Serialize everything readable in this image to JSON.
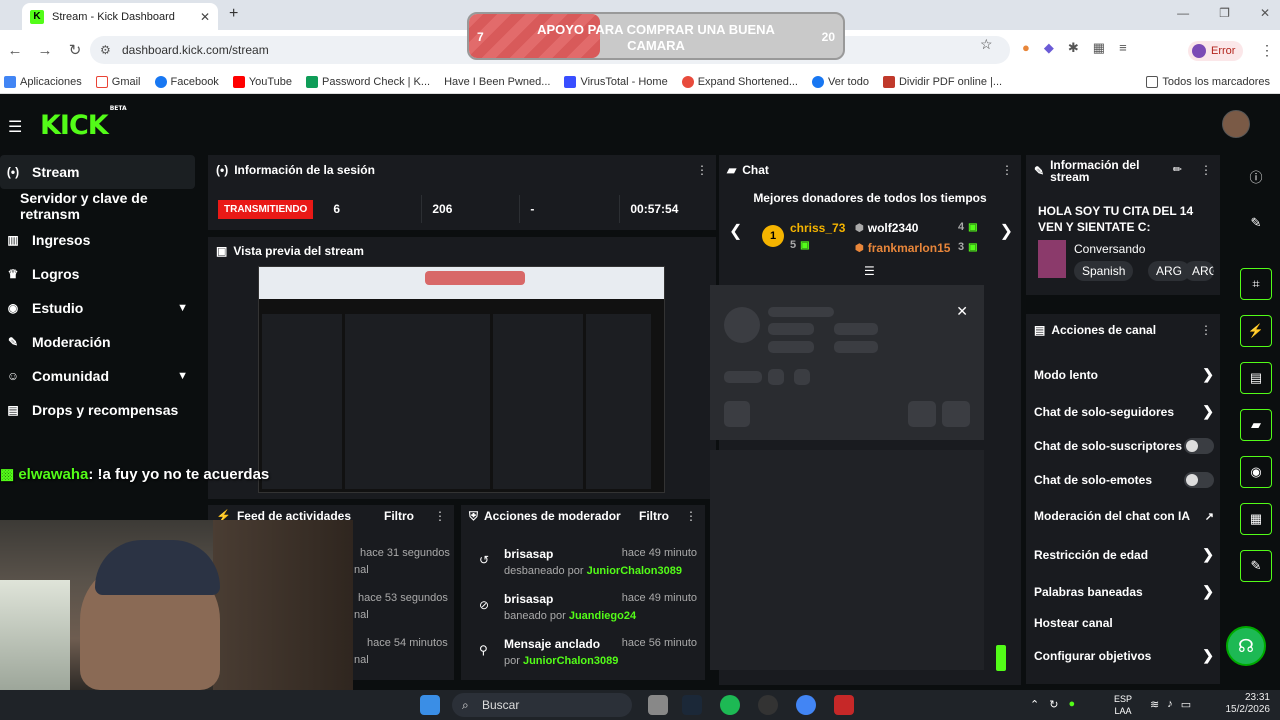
{
  "browser": {
    "tab_title": "Stream - Kick Dashboard",
    "url": "dashboard.kick.com/stream",
    "profile_label": "Error",
    "bookmarks": [
      "Aplicaciones",
      "Gmail",
      "Facebook",
      "YouTube",
      "Password Check | K...",
      "Have I Been Pwned...",
      "VirusTotal - Home",
      "Expand Shortened...",
      "Ver todo",
      "Dividir PDF online |..."
    ],
    "all_bookmarks": "Todos los marcadores"
  },
  "overlay": {
    "goal_text": "APOYO PARA COMPRAR UNA BUENA CAMARA",
    "goal_start": "7",
    "goal_end": "20",
    "goal_progress": 0.35,
    "chat_user": "elwawaha",
    "chat_message": ": !a fuy yo no te acuerdas"
  },
  "sidebar": {
    "items": [
      {
        "label": "Stream",
        "icon": "broadcast-icon"
      },
      {
        "label": "Servidor y clave de retransm",
        "icon": ""
      },
      {
        "label": "Ingresos",
        "icon": "chart-icon"
      },
      {
        "label": "Logros",
        "icon": "trophy-icon"
      },
      {
        "label": "Estudio",
        "icon": "palette-icon"
      },
      {
        "label": "Moderación",
        "icon": "wrench-icon"
      },
      {
        "label": "Comunidad",
        "icon": "people-icon"
      },
      {
        "label": "Drops y recompensas",
        "icon": "gift-icon"
      }
    ]
  },
  "session": {
    "title": "Información de la sesión",
    "status": "TRANSMITIENDO",
    "viewers": "6",
    "followers": "206",
    "subs": "-",
    "duration": "00:57:54"
  },
  "preview": {
    "title": "Vista previa del stream"
  },
  "feed": {
    "title": "Feed de actividades",
    "filter": "Filtro",
    "rows": [
      {
        "time": "hace 31 segundos",
        "text": "nal"
      },
      {
        "time": "hace 53 segundos",
        "text": "nal"
      },
      {
        "time": "hace 54 minutos",
        "text": "nal"
      }
    ]
  },
  "modactions": {
    "title": "Acciones de moderador",
    "filter": "Filtro",
    "rows": [
      {
        "name": "brisasap",
        "time": "hace 49 minuto",
        "action": "desbaneado por",
        "by": "JuniorChalon3089"
      },
      {
        "name": "brisasap",
        "time": "hace 49 minuto",
        "action": "baneado por",
        "by": "Juandiego24"
      },
      {
        "name": "Mensaje anclado",
        "time": "hace 56 minuto",
        "action": "por",
        "by": "JuniorChalon3089"
      }
    ]
  },
  "chat": {
    "title": "Chat",
    "donors_title": "Mejores donadores de todos los tiempos",
    "donors": [
      {
        "name": "chriss_73",
        "count": "5",
        "color": "#f5b400"
      },
      {
        "name": "wolf2340",
        "count": "4",
        "color": "#ffffff"
      },
      {
        "name": "frankmarlon15",
        "count": "3",
        "color": "#e8863a"
      }
    ],
    "medal": "1"
  },
  "info": {
    "title": "Información del stream",
    "stream_title": "HOLA SOY TU CITA DEL 14 VEN Y SIENTATE C:",
    "category": "Conversando",
    "tags": [
      "Spanish",
      "ARG",
      "ARG"
    ]
  },
  "actions": {
    "title": "Acciones de canal",
    "items": [
      {
        "label": "Modo lento",
        "type": "chevron"
      },
      {
        "label": "Chat de solo-seguidores",
        "type": "chevron"
      },
      {
        "label": "Chat de solo-suscriptores",
        "type": "toggle"
      },
      {
        "label": "Chat de solo-emotes",
        "type": "toggle"
      },
      {
        "label": "Moderación del chat con IA",
        "type": "external"
      },
      {
        "label": "Restricción de edad",
        "type": "chevron"
      },
      {
        "label": "Palabras baneadas",
        "type": "chevron"
      },
      {
        "label": "Hostear canal",
        "type": "none"
      },
      {
        "label": "Configurar objetivos",
        "type": "chevron"
      }
    ]
  },
  "taskbar": {
    "search": "Buscar",
    "lang1": "ESP",
    "lang2": "LAA",
    "time": "23:31",
    "date": "15/2/2026"
  },
  "colors": {
    "brand": "#53fc18",
    "live": "#e91916",
    "panel": "#191b1f"
  }
}
